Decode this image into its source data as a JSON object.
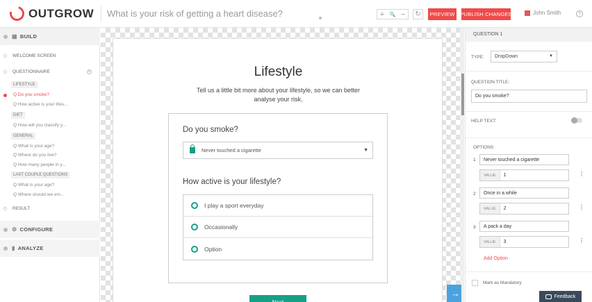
{
  "topbar": {
    "brand": "OUTGROW",
    "calculator_title": "What is your risk of getting a heart disease?",
    "zoom_in": "+",
    "zoom_search": "🔍",
    "zoom_out": "−",
    "refresh": "↻",
    "preview_label": "PREVIEW",
    "publish_label": "PUBLISH CHANGES",
    "user_name": "John Smith",
    "help": "?"
  },
  "sidebar": {
    "build": "BUILD",
    "welcome": "WELCOME SCREEN",
    "questionnaire": "QUESTIONNAIRE",
    "add": "+",
    "groups": {
      "lifestyle": "LIFESTYLE",
      "diet": "DIET",
      "general": "GENERAL",
      "last": "LAST COUPLE QUESTIONS"
    },
    "questions": [
      "Q Do you smoke?",
      "Q How active is your lifes...",
      "Q How will you classify y...",
      "Q What is your age?",
      "Q Where do you live?",
      "Q How many people in y...",
      "Q What is your age?",
      "Q Where should we em..."
    ],
    "result": "RESULT",
    "configure": "CONFIGURE",
    "analyze": "ANALYZE"
  },
  "page": {
    "title": "Lifestyle",
    "subtitle": "Tell us a little bit more about your lifestyle, so we can better analyse your risk.",
    "q1": "Do you smoke?",
    "q1_selected": "Never touched a cigarette",
    "q2": "How active is your lifestyle?",
    "q2_options": [
      "I play a sport everyday",
      "Occasionally",
      "Option"
    ],
    "next": "Next",
    "arrow": "→"
  },
  "panel": {
    "header": "QUESTION 1",
    "type_label": "TYPE:",
    "type_value": "DropDown",
    "title_label": "QUESTION TITLE:",
    "title_value": "Do you smoke?",
    "help_label": "HELP TEXT:",
    "options_label": "OPTIONS:",
    "value_tag": "VALUE",
    "options": [
      {
        "num": "1",
        "label": "Never touched a cigarette",
        "value": "1"
      },
      {
        "num": "2",
        "label": "Once in a while",
        "value": "2"
      },
      {
        "num": "3",
        "label": "A pack a day",
        "value": "3"
      }
    ],
    "add_option": "Add Option",
    "mandatory": "Mark as Mandatory"
  },
  "feedback": "Feedback",
  "colors": {
    "accent_red": "#f04a4a",
    "accent_green": "#16a085",
    "arrow_blue": "#4aa3df"
  }
}
